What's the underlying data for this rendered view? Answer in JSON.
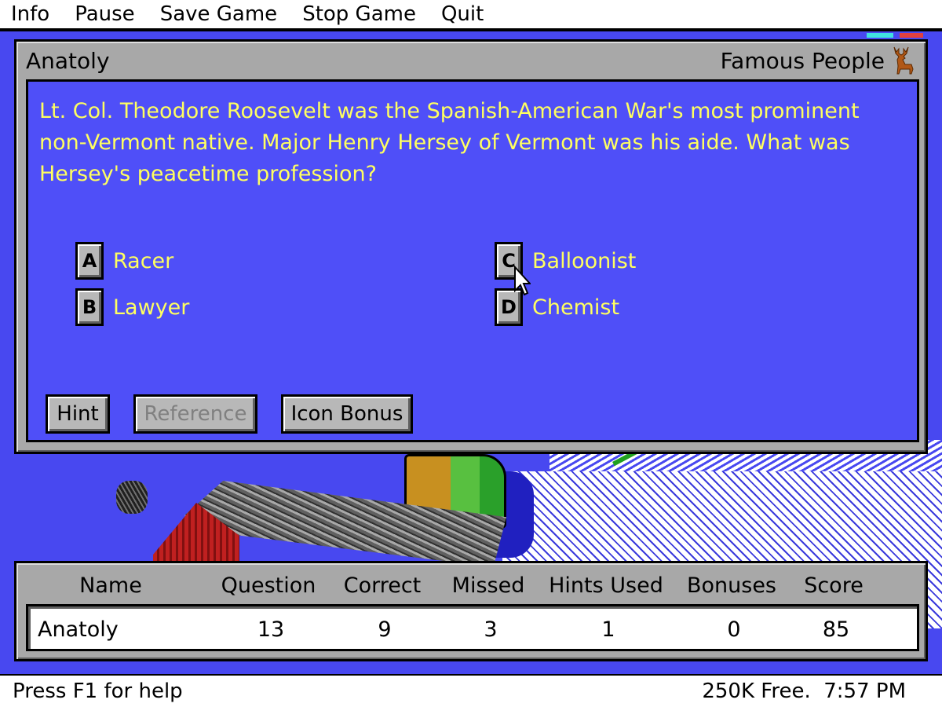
{
  "menu": {
    "items": [
      "Info",
      "Pause",
      "Save Game",
      "Stop Game",
      "Quit"
    ]
  },
  "dialog": {
    "player": "Anatoly",
    "category": "Famous People",
    "category_icon": "deer-icon",
    "question": "Lt. Col. Theodore Roosevelt was the Spanish-American War's most prominent non-Vermont native. Major Henry Hersey of Vermont was his aide. What was Hersey's peacetime profession?",
    "answers": [
      {
        "key": "A",
        "text": "Racer"
      },
      {
        "key": "B",
        "text": "Lawyer"
      },
      {
        "key": "C",
        "text": "Balloonist"
      },
      {
        "key": "D",
        "text": "Chemist"
      }
    ],
    "buttons": {
      "hint": "Hint",
      "reference": "Reference",
      "icon_bonus": "Icon Bonus"
    }
  },
  "scoreboard": {
    "headers": [
      "Name",
      "Question",
      "Correct",
      "Missed",
      "Hints Used",
      "Bonuses",
      "Score"
    ],
    "row": [
      "Anatoly",
      "13",
      "9",
      "3",
      "1",
      "0",
      "85"
    ]
  },
  "status": {
    "help": "Press F1 for help",
    "info": "250K Free.  7:57 PM"
  },
  "colors": {
    "panel_blue": "#4f4ff8",
    "question_text": "#ffff60",
    "gray": "#a8a8a8"
  }
}
